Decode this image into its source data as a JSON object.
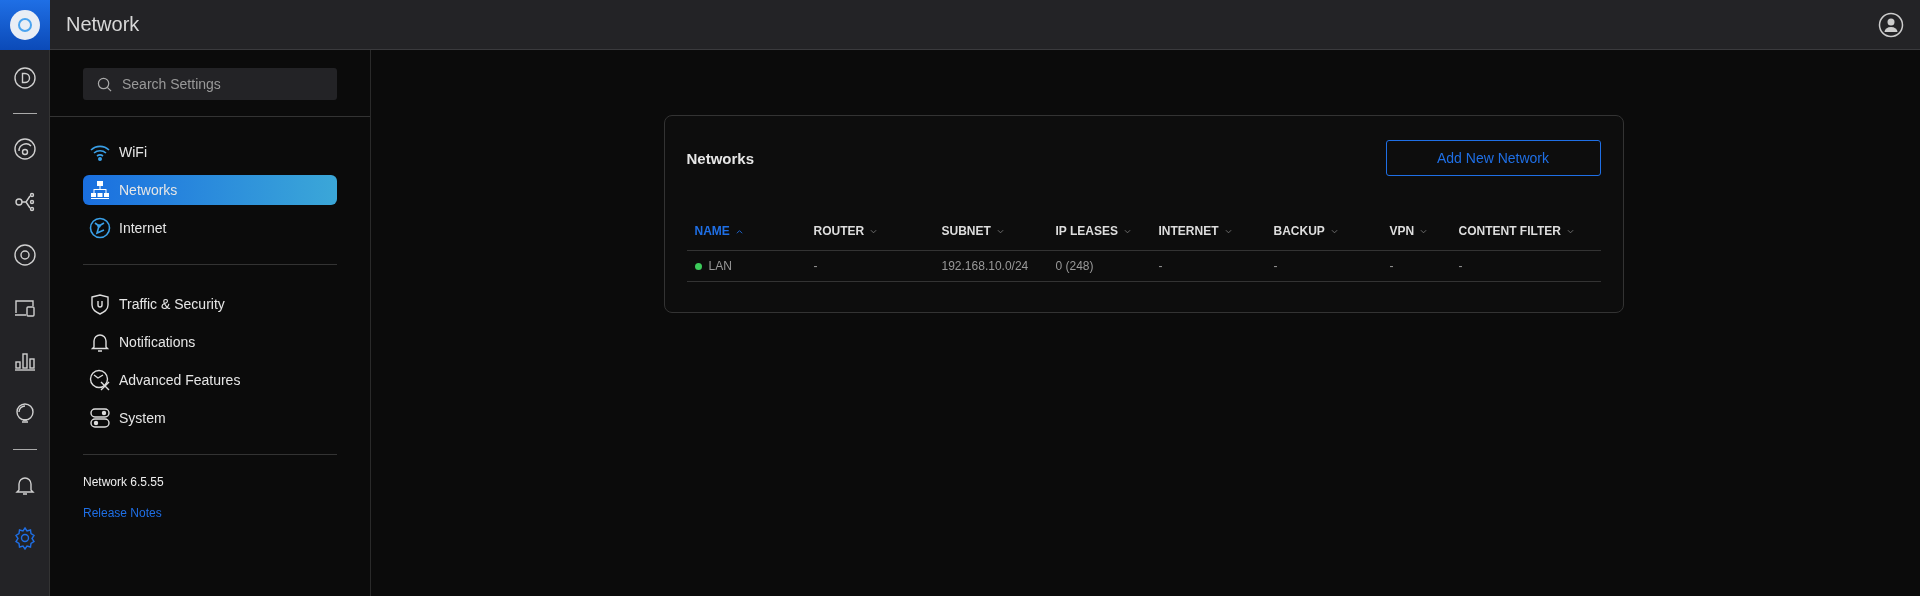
{
  "header": {
    "title": "Network"
  },
  "rail": [
    {
      "selected": false
    },
    {
      "selected": false
    },
    {
      "selected": false
    },
    {
      "selected": false
    },
    {
      "selected": false
    },
    {
      "selected": false
    },
    {
      "selected": false
    },
    {
      "selected": false
    },
    {
      "selected": true
    }
  ],
  "settings": {
    "search": {
      "placeholder": "Search Settings"
    },
    "groups": [
      [
        {
          "label": "WiFi",
          "selected": false
        },
        {
          "label": "Networks",
          "selected": true
        },
        {
          "label": "Internet",
          "selected": false
        }
      ],
      [
        {
          "label": "Traffic & Security",
          "selected": false
        },
        {
          "label": "Notifications",
          "selected": false
        },
        {
          "label": "Advanced Features",
          "selected": false
        },
        {
          "label": "System",
          "selected": false
        }
      ]
    ],
    "version": "Network 6.5.55",
    "release_notes": "Release Notes"
  },
  "card": {
    "title": "Networks",
    "add_button": "Add New Network",
    "columns": [
      {
        "label": "NAME",
        "selected": true
      },
      {
        "label": "ROUTER",
        "selected": false
      },
      {
        "label": "SUBNET",
        "selected": false
      },
      {
        "label": "IP LEASES",
        "selected": false
      },
      {
        "label": "INTERNET",
        "selected": false
      },
      {
        "label": "BACKUP",
        "selected": false
      },
      {
        "label": "VPN",
        "selected": false
      },
      {
        "label": "CONTENT FILTER",
        "selected": false
      }
    ],
    "rows": [
      {
        "color": "#3ccb5a",
        "cells": [
          "LAN",
          "-",
          "192.168.10.0/24",
          "0 (248)",
          "-",
          "-",
          "-",
          "-"
        ]
      }
    ]
  }
}
